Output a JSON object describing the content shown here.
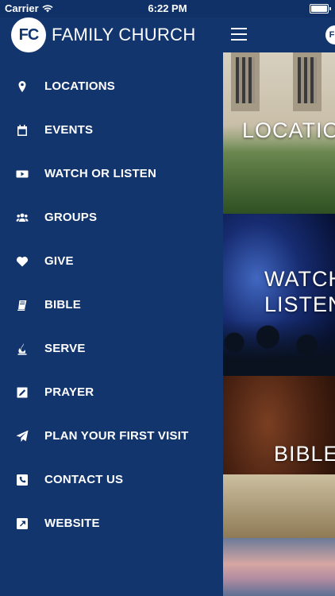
{
  "status_bar": {
    "carrier": "Carrier",
    "time": "6:22 PM"
  },
  "brand": {
    "logo_text": "FC",
    "name": "FAMILY CHURCH"
  },
  "menu": [
    {
      "label": "LOCATIONS",
      "icon": "location-pin-icon"
    },
    {
      "label": "EVENTS",
      "icon": "calendar-icon"
    },
    {
      "label": "WATCH OR LISTEN",
      "icon": "play-video-icon"
    },
    {
      "label": "GROUPS",
      "icon": "people-icon"
    },
    {
      "label": "GIVE",
      "icon": "heart-icon"
    },
    {
      "label": "BIBLE",
      "icon": "book-icon"
    },
    {
      "label": "SERVE",
      "icon": "fire-icon"
    },
    {
      "label": "PRAYER",
      "icon": "pencil-square-icon"
    },
    {
      "label": "PLAN YOUR FIRST VISIT",
      "icon": "paper-plane-icon"
    },
    {
      "label": "CONTACT US",
      "icon": "phone-square-icon"
    },
    {
      "label": "WEBSITE",
      "icon": "external-link-icon"
    }
  ],
  "main": {
    "mini_logo_text": "FC",
    "tiles": [
      {
        "title": "LOCATIO"
      },
      {
        "title_line1": "WATCH",
        "title_line2": "LISTEN"
      },
      {
        "title": "BIBLE"
      }
    ]
  },
  "colors": {
    "sidebar_bg": "#12356e",
    "text": "#ffffff"
  }
}
